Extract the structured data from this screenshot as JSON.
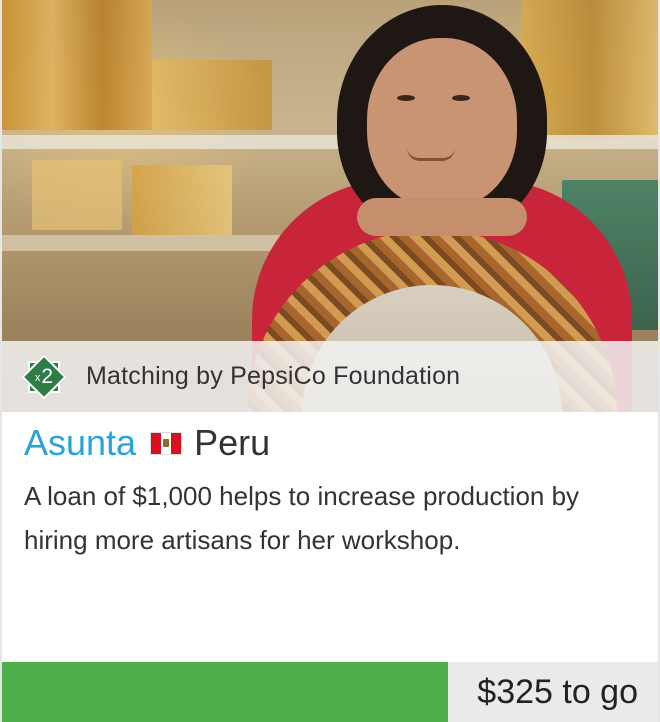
{
  "photo": {
    "subject": "borrower-photo"
  },
  "matching": {
    "badge_prefix": "x",
    "badge_multiplier": "2",
    "label": "Matching by PepsiCo Foundation",
    "badge_color": "#2e7d47"
  },
  "borrower": {
    "name": "Asunta",
    "country": "Peru",
    "flag_icon": "peru-flag-icon",
    "name_color": "#2aa3d8"
  },
  "loan": {
    "description": "A loan of $1,000 helps to increase production by hiring more artisans for her workshop."
  },
  "progress": {
    "label": "$325 to go",
    "funded_fraction": 0.68,
    "fill_color": "#4faf4a"
  }
}
